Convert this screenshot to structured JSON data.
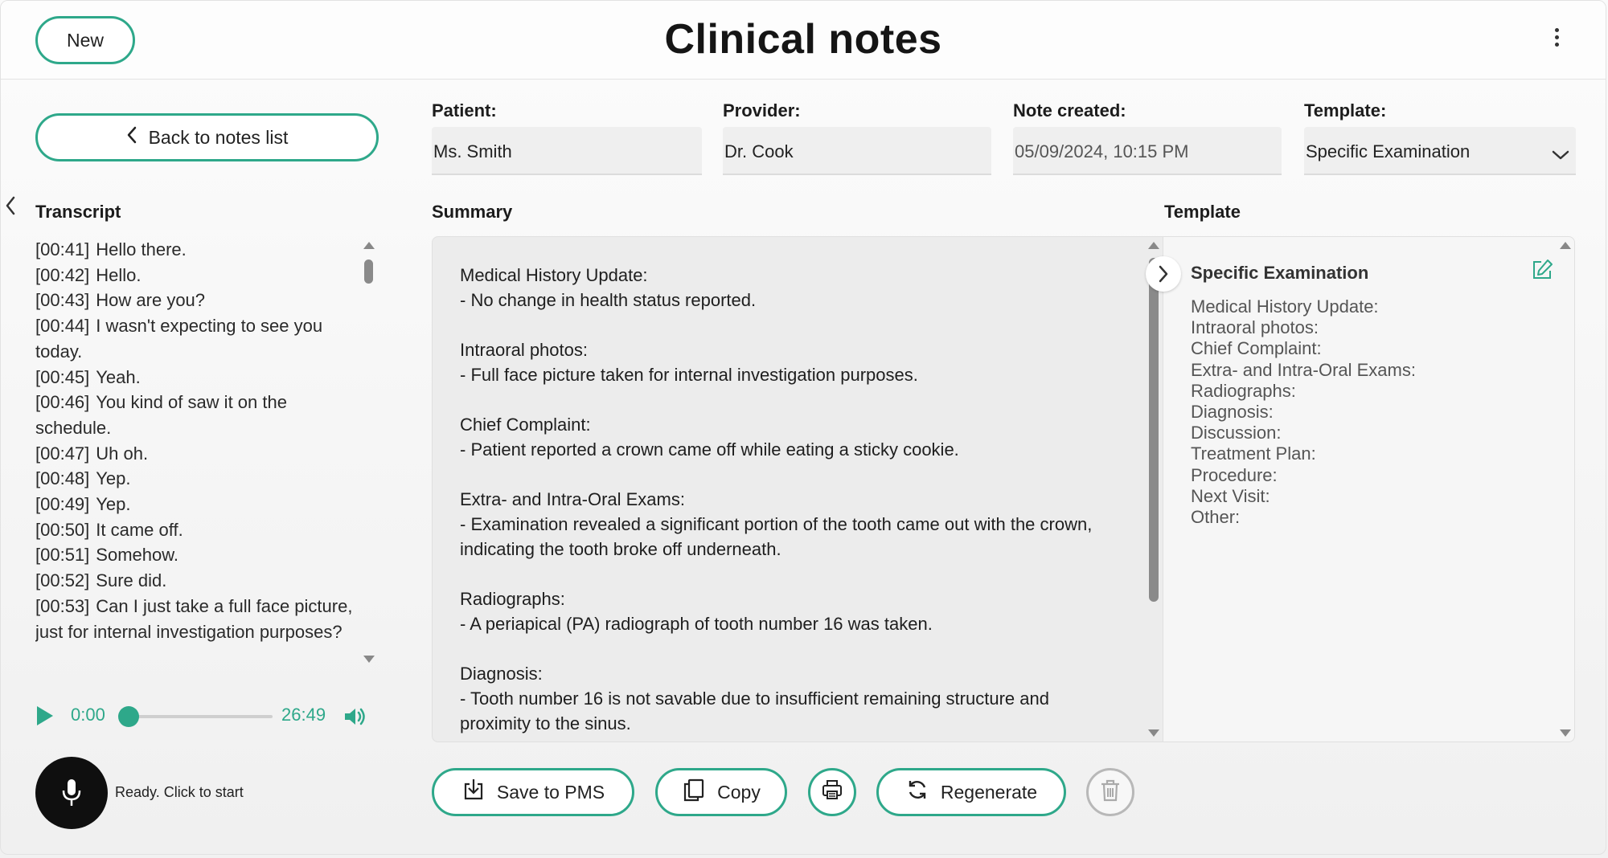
{
  "header": {
    "new_label": "New",
    "title": "Clinical notes"
  },
  "sidebar": {
    "back_label": "Back to notes list",
    "transcript_heading": "Transcript",
    "transcript": [
      {
        "ts": "[00:41]",
        "text": "Hello there."
      },
      {
        "ts": "[00:42]",
        "text": "Hello."
      },
      {
        "ts": "[00:43]",
        "text": "How are you?"
      },
      {
        "ts": "[00:44]",
        "text": "I wasn't expecting to see you today."
      },
      {
        "ts": "[00:45]",
        "text": "Yeah."
      },
      {
        "ts": "[00:46]",
        "text": "You kind of saw it on the schedule."
      },
      {
        "ts": "[00:47]",
        "text": "Uh oh."
      },
      {
        "ts": "[00:48]",
        "text": "Yep."
      },
      {
        "ts": "[00:49]",
        "text": "Yep."
      },
      {
        "ts": "[00:50]",
        "text": "It came off."
      },
      {
        "ts": "[00:51]",
        "text": "Somehow."
      },
      {
        "ts": "[00:52]",
        "text": "Sure did."
      },
      {
        "ts": "[00:53]",
        "text": "Can I just take a full face picture, just for internal investigation purposes?"
      }
    ],
    "player": {
      "current_time": "0:00",
      "duration": "26:49",
      "progress": 0
    },
    "mic_status": "Ready. Click to start"
  },
  "fields": {
    "patient_label": "Patient:",
    "patient_value": "Ms. Smith",
    "provider_label": "Provider:",
    "provider_value": "Dr. Cook",
    "created_label": "Note created:",
    "created_value": "05/09/2024, 10:15 PM",
    "template_label": "Template:",
    "template_value": "Specific Examination"
  },
  "summary": {
    "heading": "Summary",
    "blocks": [
      {
        "title": "Medical History Update:",
        "lines": [
          "- No change in health status reported."
        ]
      },
      {
        "title": "Intraoral photos:",
        "lines": [
          "- Full face picture taken for internal investigation purposes."
        ]
      },
      {
        "title": "Chief Complaint:",
        "lines": [
          "- Patient reported a crown came off while eating a sticky cookie."
        ]
      },
      {
        "title": "Extra- and Intra-Oral Exams:",
        "lines": [
          "- Examination revealed a significant portion of the tooth came out with the crown, indicating the tooth broke off underneath."
        ]
      },
      {
        "title": "Radiographs:",
        "lines": [
          "- A periapical (PA) radiograph of tooth number 16 was taken."
        ]
      },
      {
        "title": "Diagnosis:",
        "lines": [
          "- Tooth number 16 is not savable due to insufficient remaining structure and proximity to the sinus."
        ]
      }
    ]
  },
  "template_panel": {
    "heading": "Template",
    "title": "Specific Examination",
    "items": [
      "Medical History Update:",
      "Intraoral photos:",
      "Chief Complaint:",
      "Extra- and Intra-Oral Exams:",
      "Radiographs:",
      "Diagnosis:",
      "Discussion:",
      "Treatment Plan:",
      "Procedure:",
      "Next Visit:",
      "Other:"
    ]
  },
  "actions": {
    "save_label": "Save to PMS",
    "copy_label": "Copy",
    "regenerate_label": "Regenerate"
  },
  "colors": {
    "accent": "#2ea88a",
    "mic_bg": "#0f0f0f"
  },
  "icons": [
    "kebab-menu-icon",
    "chevron-left-icon",
    "play-icon",
    "volume-icon",
    "microphone-icon",
    "chevron-down-icon",
    "chevron-right-icon",
    "edit-icon",
    "download-icon",
    "copy-icon",
    "print-icon",
    "refresh-icon",
    "trash-icon"
  ]
}
